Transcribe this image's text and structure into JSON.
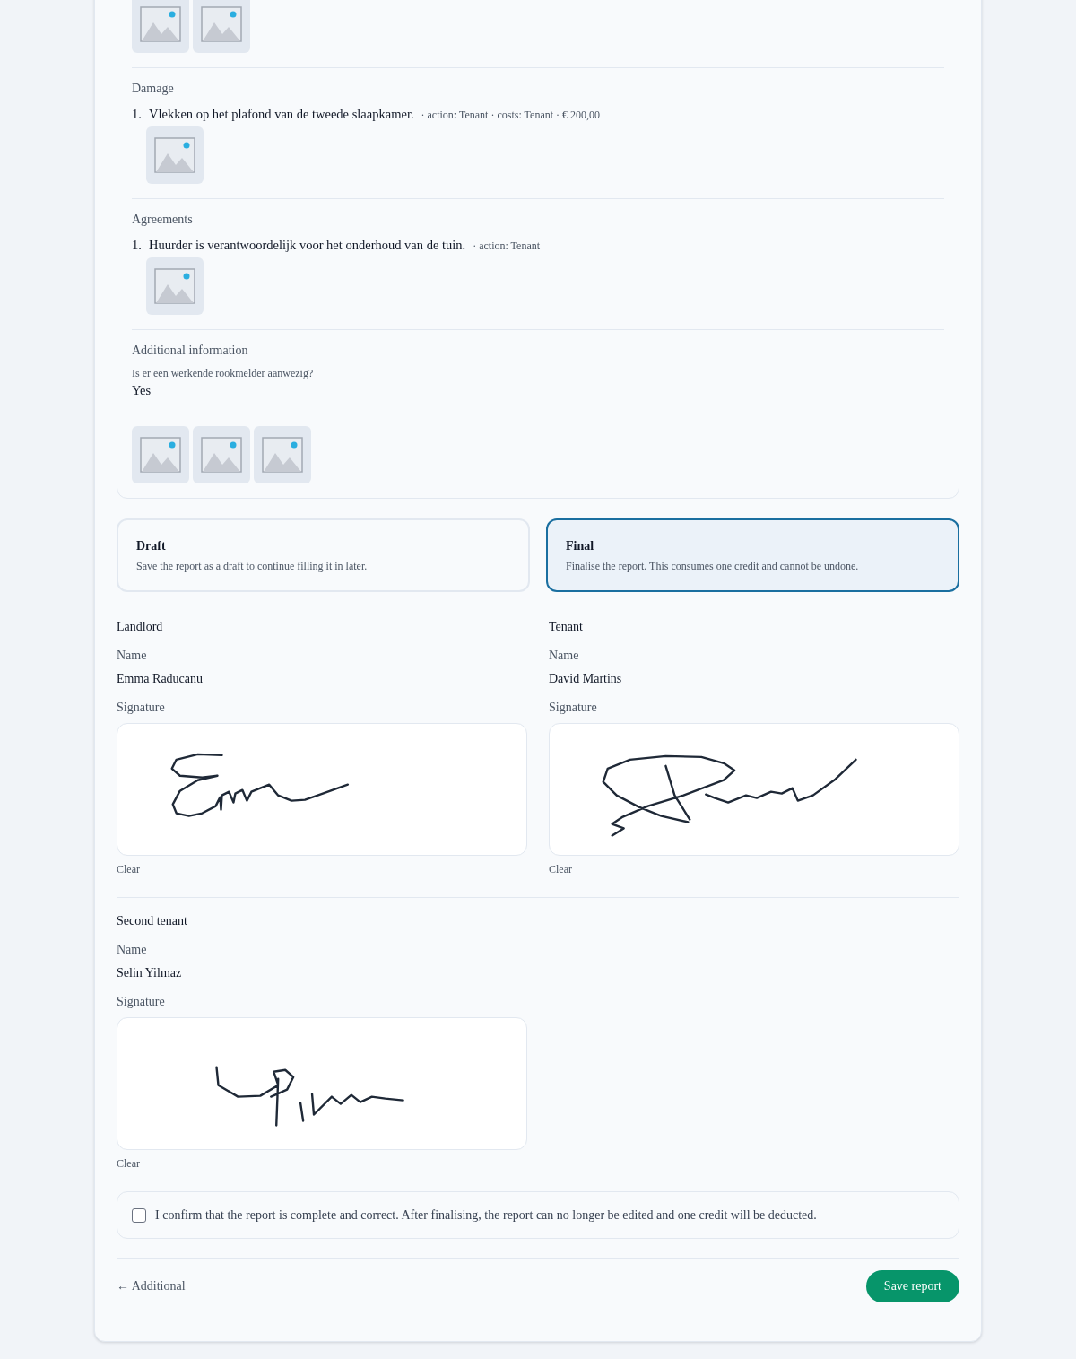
{
  "summary": {
    "sections": [
      {
        "photos": [
          {
            "kind": "placeholder"
          },
          {
            "kind": "placeholder"
          }
        ]
      },
      {
        "title": "Damage",
        "items": [
          {
            "number": "1.",
            "text": "Vlekken op het plafond van de tweede slaapkamer.",
            "meta": "· action: Tenant · costs: Tenant · € 200,00",
            "photos": [
              {
                "kind": "placeholder"
              }
            ]
          }
        ]
      },
      {
        "title": "Agreements",
        "items": [
          {
            "number": "1.",
            "text": "Huurder is verantwoordelijk voor het onderhoud van de tuin.",
            "meta": "· action: Tenant",
            "photos": [
              {
                "kind": "placeholder"
              }
            ]
          }
        ]
      },
      {
        "title": "Additional information",
        "questions": [
          {
            "question": "Is er een werkende rookmelder aanwezig?",
            "answer": "Yes"
          }
        ]
      },
      {
        "photos": [
          {
            "kind": "placeholder"
          },
          {
            "kind": "placeholder"
          },
          {
            "kind": "placeholder"
          }
        ]
      }
    ]
  },
  "report_types": [
    {
      "title": "Draft",
      "description": "Save the report as a draft to continue filling it in later.",
      "selected": false
    },
    {
      "title": "Final",
      "description": "Finalise the report. This consumes one credit and cannot be undone.",
      "selected": true
    }
  ],
  "signer_rows": [
    {
      "signers": [
        {
          "role": "Landlord",
          "name_label": "Name",
          "name": "Emma Raducanu",
          "signature_label": "Signature",
          "signed": true,
          "clear": "Clear"
        },
        {
          "role": "Tenant",
          "name_label": "Name",
          "name": "David Martins",
          "signature_label": "Signature",
          "signed": true,
          "clear": "Clear"
        }
      ]
    },
    {
      "signers": [
        {
          "role": "Second tenant",
          "name_label": "Name",
          "name": "Selin Yilmaz",
          "signature_label": "Signature",
          "signed": true,
          "clear": "Clear"
        }
      ]
    }
  ],
  "confirmation": {
    "text": "I confirm that the report is complete and correct. After finalising, the report can no longer be edited and one credit will be deducted.",
    "checked": false
  },
  "footer": {
    "back": "← Additional",
    "save": "Save report"
  }
}
